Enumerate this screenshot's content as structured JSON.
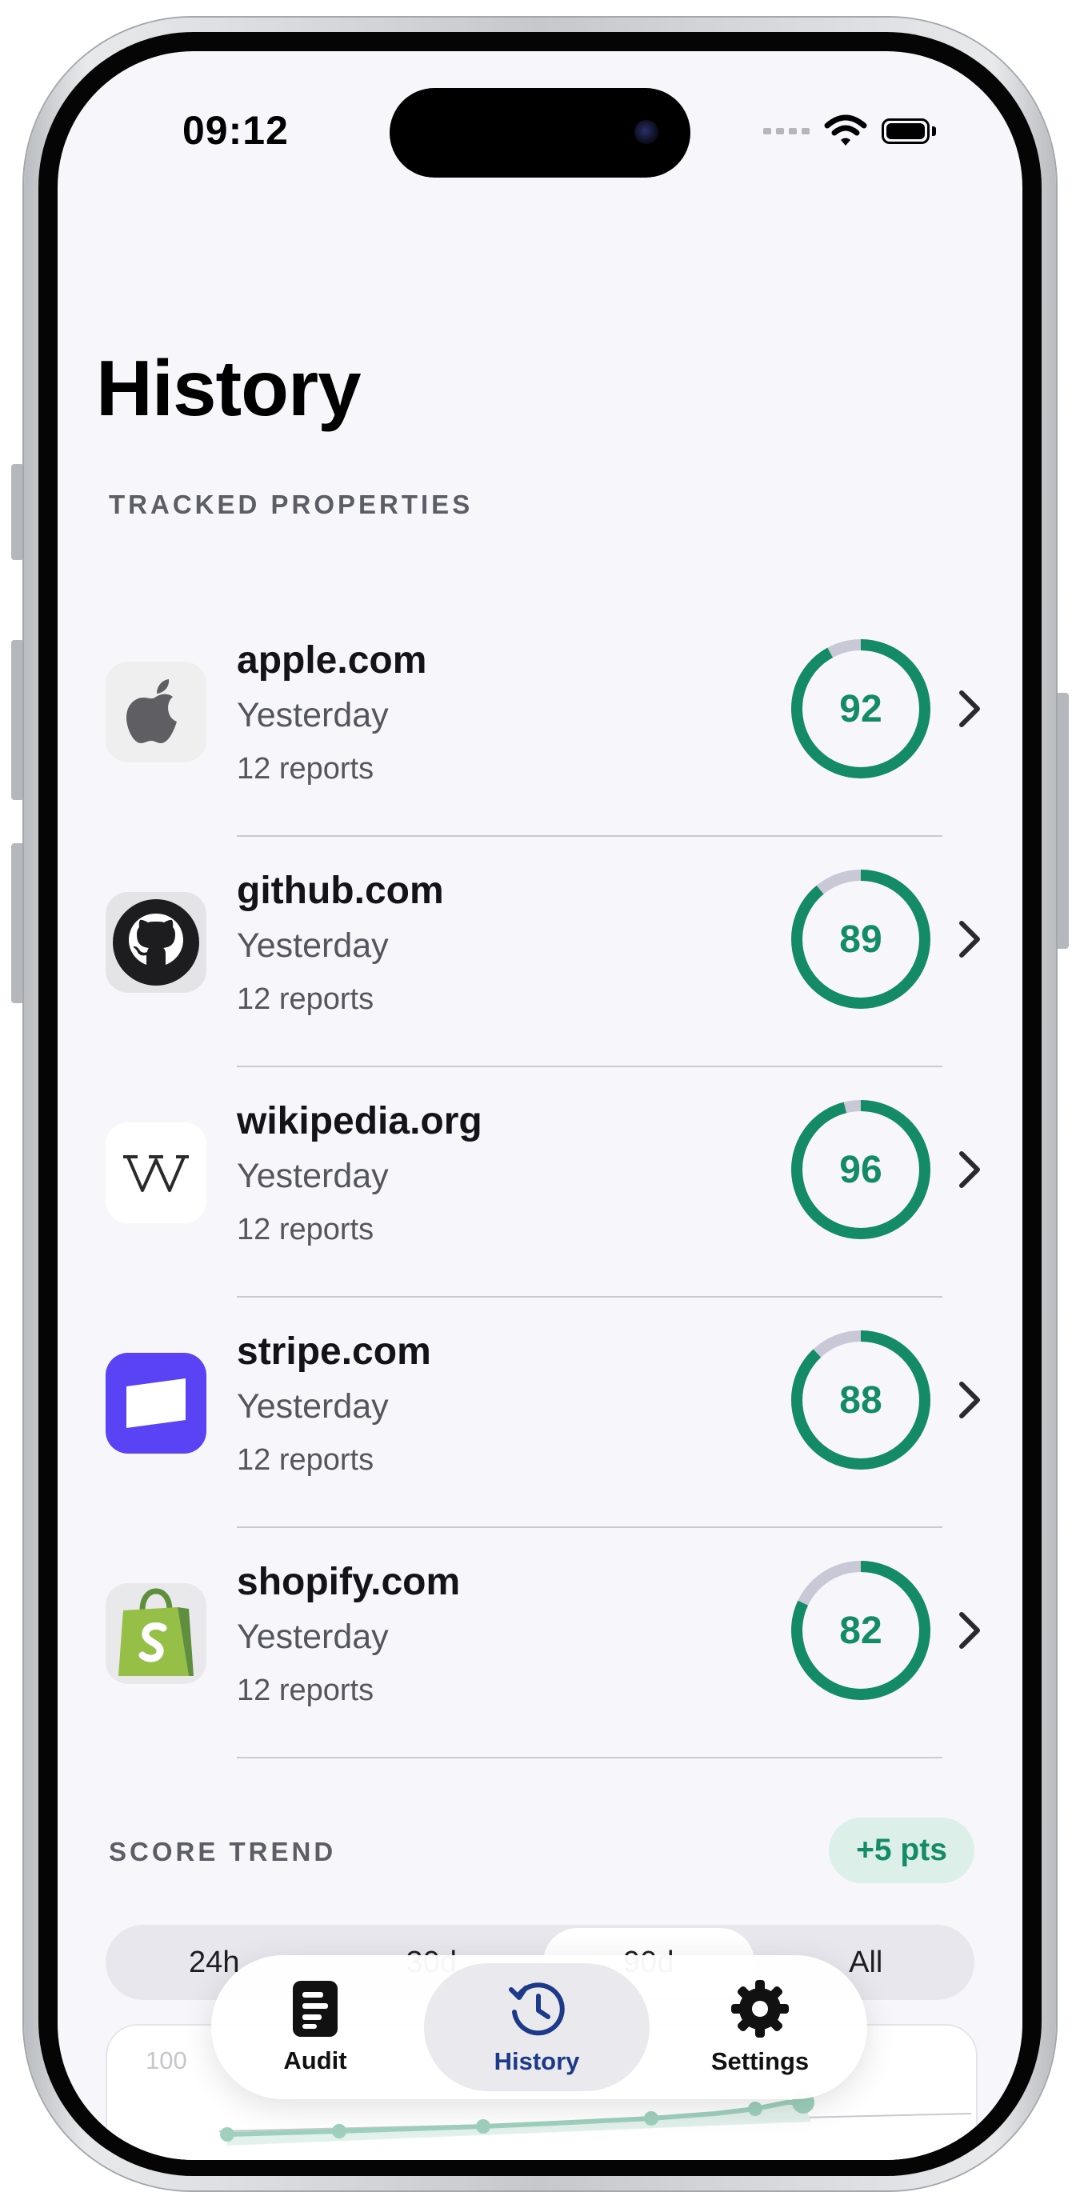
{
  "status_bar": {
    "time": "09:12"
  },
  "page": {
    "title": "History"
  },
  "sections": {
    "tracked": "TRACKED PROPERTIES",
    "trend": "SCORE TREND"
  },
  "properties": [
    {
      "name": "apple.com",
      "date": "Yesterday",
      "reports": "12 reports",
      "score": 92,
      "logo": "apple-logo-icon"
    },
    {
      "name": "github.com",
      "date": "Yesterday",
      "reports": "12 reports",
      "score": 89,
      "logo": "github-logo-icon"
    },
    {
      "name": "wikipedia.org",
      "date": "Yesterday",
      "reports": "12 reports",
      "score": 96,
      "logo": "wikipedia-logo-icon"
    },
    {
      "name": "stripe.com",
      "date": "Yesterday",
      "reports": "12 reports",
      "score": 88,
      "logo": "stripe-logo-icon"
    },
    {
      "name": "shopify.com",
      "date": "Yesterday",
      "reports": "12 reports",
      "score": 82,
      "logo": "shopify-logo-icon"
    }
  ],
  "trend": {
    "badge": "+5 pts",
    "ranges": [
      "24h",
      "30d",
      "90d",
      "All"
    ],
    "selected_range": "90d",
    "y_max_label": "100"
  },
  "tabs": [
    {
      "label": "Audit",
      "icon": "document-icon"
    },
    {
      "label": "History",
      "icon": "clock-history-icon"
    },
    {
      "label": "Settings",
      "icon": "gear-icon"
    }
  ],
  "selected_tab": "History",
  "colors": {
    "accent_green": "#148a66",
    "ring_track": "#c8c8d6",
    "tab_active": "#1c3a87"
  }
}
